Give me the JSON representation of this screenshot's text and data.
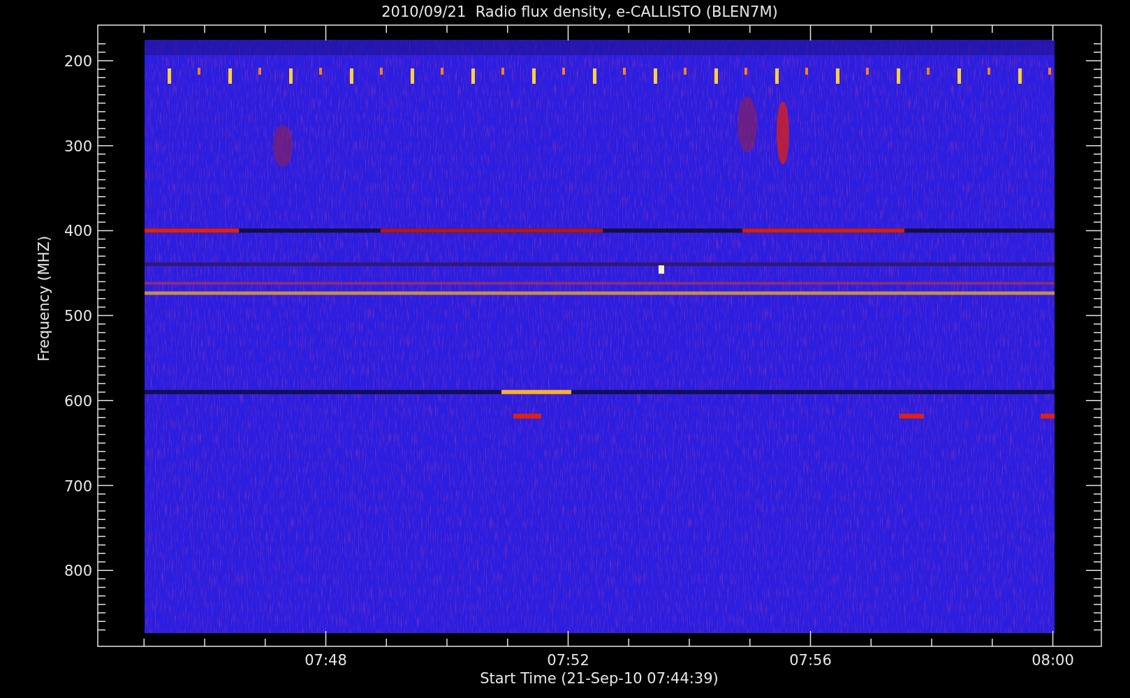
{
  "title": "2010/09/21  Radio flux density, e-CALLISTO (BLEN7M)",
  "y_axis": {
    "label": "Frequency (MHZ)",
    "ticks": [
      "200",
      "300",
      "400",
      "500",
      "600",
      "700",
      "800"
    ]
  },
  "x_axis": {
    "label": "Start Time (21-Sep-10 07:44:39)",
    "ticks": [
      "07:48",
      "07:52",
      "07:56",
      "08:00"
    ]
  }
}
